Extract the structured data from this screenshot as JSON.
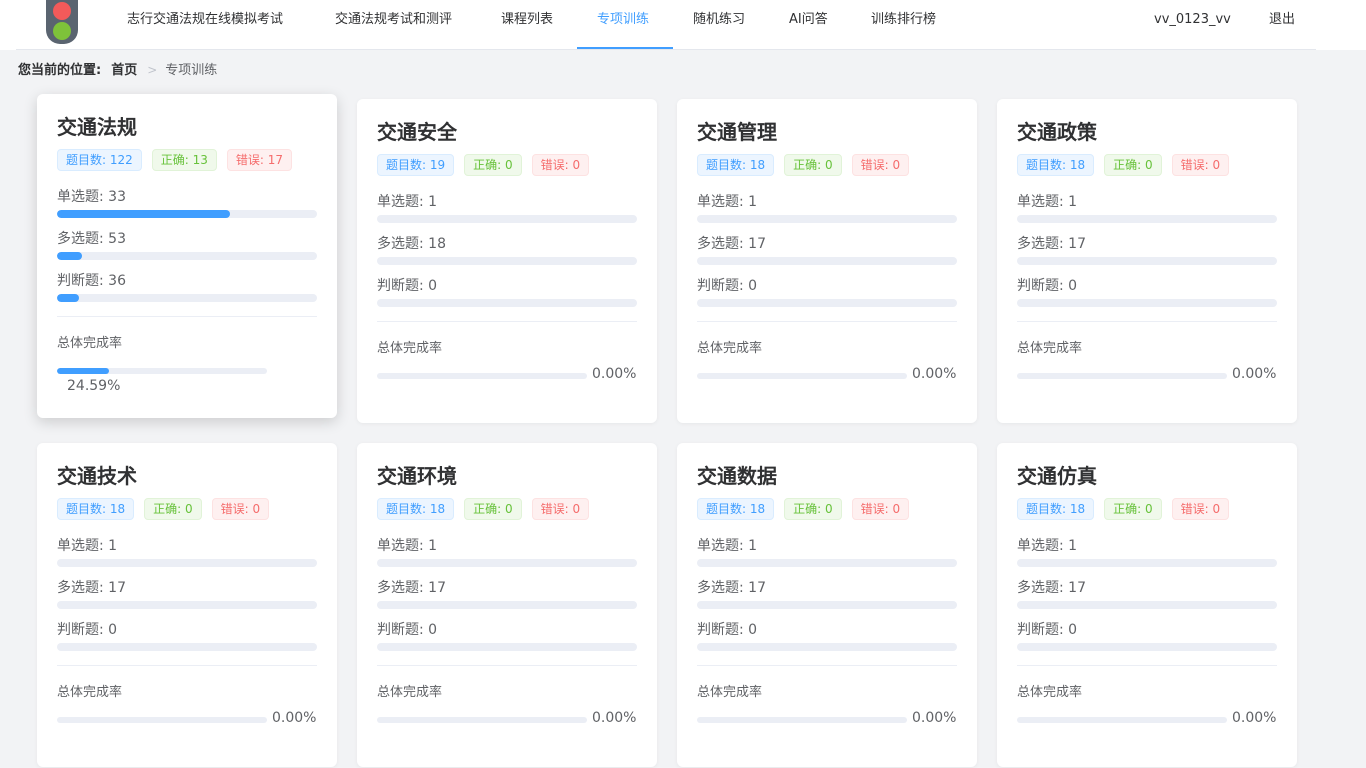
{
  "header": {
    "logo": "traffic-light-logo",
    "nav": [
      {
        "label": "志行交通法规在线模拟考试"
      },
      {
        "label": "交通法规考试和测评"
      },
      {
        "label": "课程列表"
      },
      {
        "label": "专项训练",
        "active": true
      },
      {
        "label": "随机练习"
      },
      {
        "label": "AI问答"
      },
      {
        "label": "训练排行榜"
      }
    ],
    "username": "vv_0123_vv",
    "logout": "退出",
    "accent_color": "#409eff"
  },
  "breadcrumb": {
    "lead": "您当前的位置:",
    "home": "首页",
    "separator": ">",
    "current": "专项训练"
  },
  "cards": [
    {
      "title": "交通法规",
      "total_tag": "题目数: 122",
      "correct_tag": "正确: 13",
      "wrong_tag": "错误: 17",
      "single": "单选题: 33",
      "single_progress": 0.665,
      "multi": "多选题: 53",
      "multi_progress": 0.095,
      "judge": "判断题: 36",
      "judge_progress": 0.085,
      "total_label": "总体完成率",
      "total_pct": "24.59%",
      "total_progress": 0.2459
    },
    {
      "title": "交通安全",
      "total_tag": "题目数: 19",
      "correct_tag": "正确: 0",
      "wrong_tag": "错误: 0",
      "single": "单选题: 1",
      "single_progress": 0,
      "multi": "多选题: 18",
      "multi_progress": 0,
      "judge": "判断题: 0",
      "judge_progress": 0,
      "total_label": "总体完成率",
      "total_pct": "0.00%",
      "total_progress": 0
    },
    {
      "title": "交通管理",
      "total_tag": "题目数: 18",
      "correct_tag": "正确: 0",
      "wrong_tag": "错误: 0",
      "single": "单选题: 1",
      "single_progress": 0,
      "multi": "多选题: 17",
      "multi_progress": 0,
      "judge": "判断题: 0",
      "judge_progress": 0,
      "total_label": "总体完成率",
      "total_pct": "0.00%",
      "total_progress": 0
    },
    {
      "title": "交通政策",
      "total_tag": "题目数: 18",
      "correct_tag": "正确: 0",
      "wrong_tag": "错误: 0",
      "single": "单选题: 1",
      "single_progress": 0,
      "multi": "多选题: 17",
      "multi_progress": 0,
      "judge": "判断题: 0",
      "judge_progress": 0,
      "total_label": "总体完成率",
      "total_pct": "0.00%",
      "total_progress": 0
    },
    {
      "title": "交通技术",
      "total_tag": "题目数: 18",
      "correct_tag": "正确: 0",
      "wrong_tag": "错误: 0",
      "single": "单选题: 1",
      "single_progress": 0,
      "multi": "多选题: 17",
      "multi_progress": 0,
      "judge": "判断题: 0",
      "judge_progress": 0,
      "total_label": "总体完成率",
      "total_pct": "0.00%",
      "total_progress": 0
    },
    {
      "title": "交通环境",
      "total_tag": "题目数: 18",
      "correct_tag": "正确: 0",
      "wrong_tag": "错误: 0",
      "single": "单选题: 1",
      "single_progress": 0,
      "multi": "多选题: 17",
      "multi_progress": 0,
      "judge": "判断题: 0",
      "judge_progress": 0,
      "total_label": "总体完成率",
      "total_pct": "0.00%",
      "total_progress": 0
    },
    {
      "title": "交通数据",
      "total_tag": "题目数: 18",
      "correct_tag": "正确: 0",
      "wrong_tag": "错误: 0",
      "single": "单选题: 1",
      "single_progress": 0,
      "multi": "多选题: 17",
      "multi_progress": 0,
      "judge": "判断题: 0",
      "judge_progress": 0,
      "total_label": "总体完成率",
      "total_pct": "0.00%",
      "total_progress": 0
    },
    {
      "title": "交通仿真",
      "total_tag": "题目数: 18",
      "correct_tag": "正确: 0",
      "wrong_tag": "错误: 0",
      "single": "单选题: 1",
      "single_progress": 0,
      "multi": "多选题: 17",
      "multi_progress": 0,
      "judge": "判断题: 0",
      "judge_progress": 0,
      "total_label": "总体完成率",
      "total_pct": "0.00%",
      "total_progress": 0
    }
  ]
}
